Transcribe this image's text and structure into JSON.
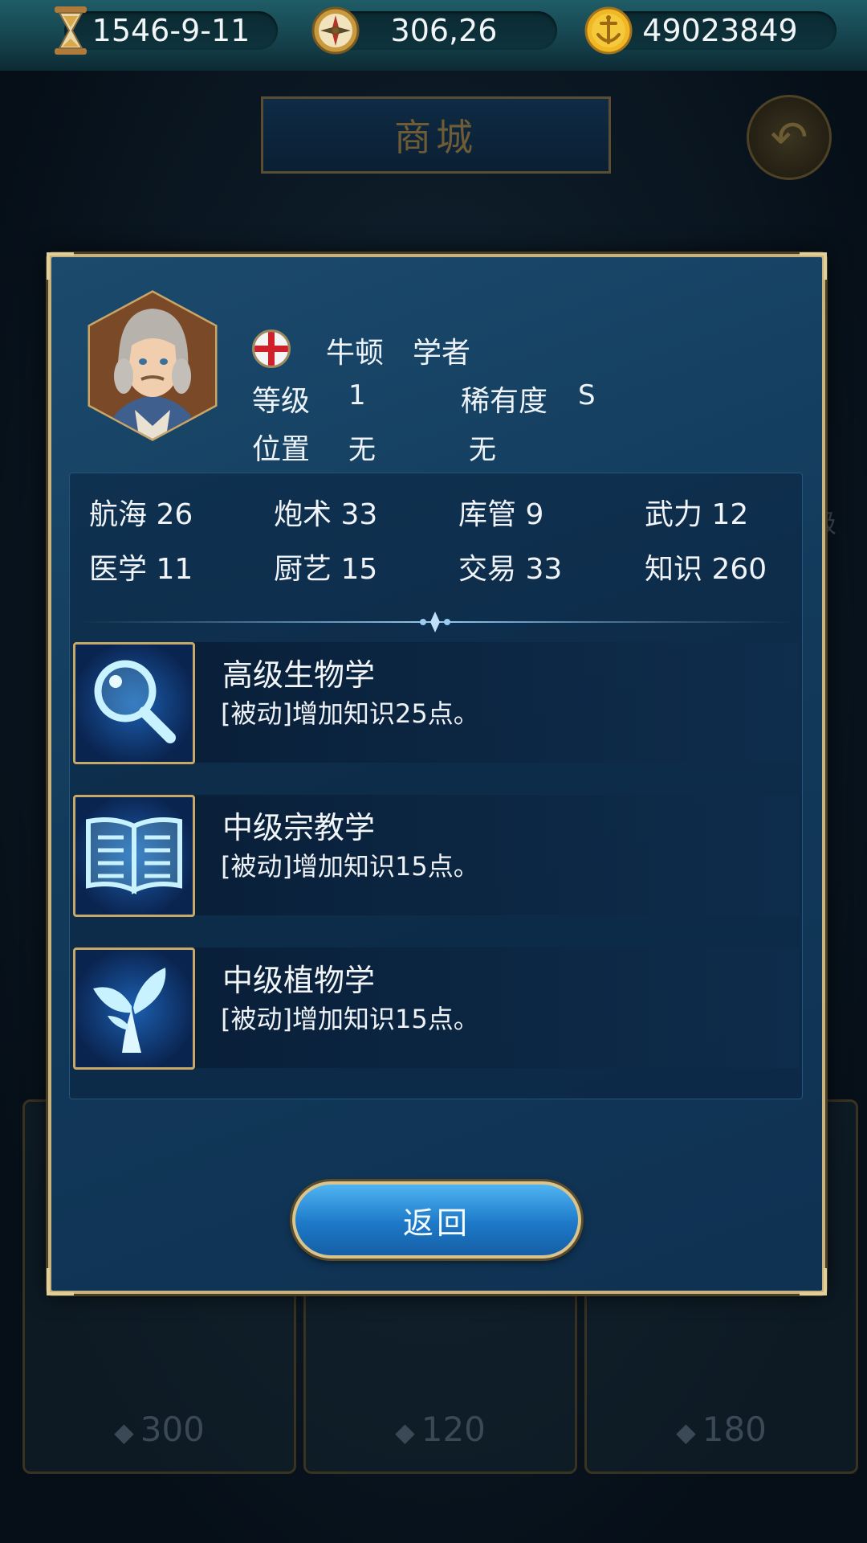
{
  "topbar": {
    "date": "1546-9-11",
    "coords": "306,26",
    "gold": "49023849",
    "icons": [
      "hourglass-icon",
      "compass-icon",
      "gold-coin-anchor-icon"
    ]
  },
  "background": {
    "title": "商城",
    "side_text": "级",
    "prices": [
      "300",
      "120",
      "180"
    ]
  },
  "character": {
    "name": "牛顿",
    "job": "学者",
    "nation_flag": "england-flag-icon",
    "level_label": "等级",
    "level": "1",
    "rarity_label": "稀有度",
    "rarity": "S",
    "position_label": "位置",
    "position_value1": "无",
    "position_value2": "无"
  },
  "stats": [
    {
      "label": "航海",
      "value": "26"
    },
    {
      "label": "炮术",
      "value": "33"
    },
    {
      "label": "库管",
      "value": "9"
    },
    {
      "label": "武力",
      "value": "12"
    },
    {
      "label": "医学",
      "value": "11"
    },
    {
      "label": "厨艺",
      "value": "15"
    },
    {
      "label": "交易",
      "value": "33"
    },
    {
      "label": "知识",
      "value": "260"
    }
  ],
  "skills": [
    {
      "name": "高级生物学",
      "desc": "[被动]增加知识25点。",
      "icon": "magnifier-icon"
    },
    {
      "name": "中级宗教学",
      "desc": "[被动]增加知识15点。",
      "icon": "open-book-icon"
    },
    {
      "name": "中级植物学",
      "desc": "[被动]增加知识15点。",
      "icon": "sprout-icon"
    }
  ],
  "buttons": {
    "return_label": "返回"
  },
  "colors": {
    "accent_gold": "#c8b27d",
    "panel_blue": "#123a5b",
    "button_blue": "#1d79c8"
  }
}
